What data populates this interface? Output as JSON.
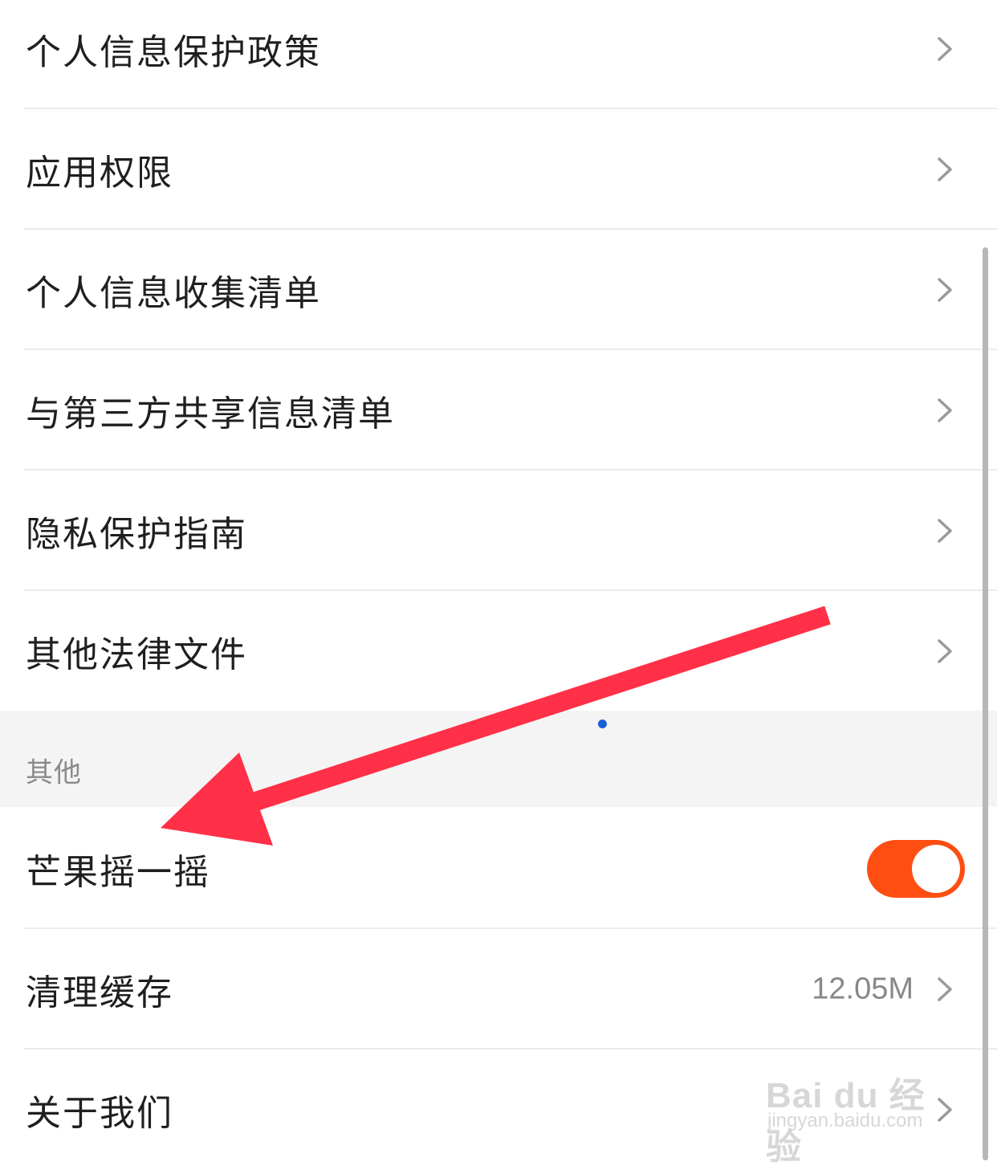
{
  "settings": {
    "items": [
      {
        "label": "个人信息保护政策"
      },
      {
        "label": "应用权限"
      },
      {
        "label": "个人信息收集清单"
      },
      {
        "label": "与第三方共享信息清单"
      },
      {
        "label": "隐私保护指南"
      },
      {
        "label": "其他法律文件"
      }
    ],
    "section_other": {
      "title": "其他",
      "shake": {
        "label": "芒果摇一摇",
        "enabled": true
      },
      "clear_cache": {
        "label": "清理缓存",
        "value": "12.05M"
      },
      "about": {
        "label": "关于我们"
      }
    }
  },
  "colors": {
    "toggle_on": "#ff4e12",
    "annotation_arrow": "#ff3047",
    "section_bg": "#f4f4f4"
  },
  "watermark": {
    "text": "Bai du 经验",
    "url": "jingyan.baidu.com"
  },
  "icons": {
    "row_chevron": "chevron-right-icon",
    "annotation": "red-arrow-annotation"
  }
}
